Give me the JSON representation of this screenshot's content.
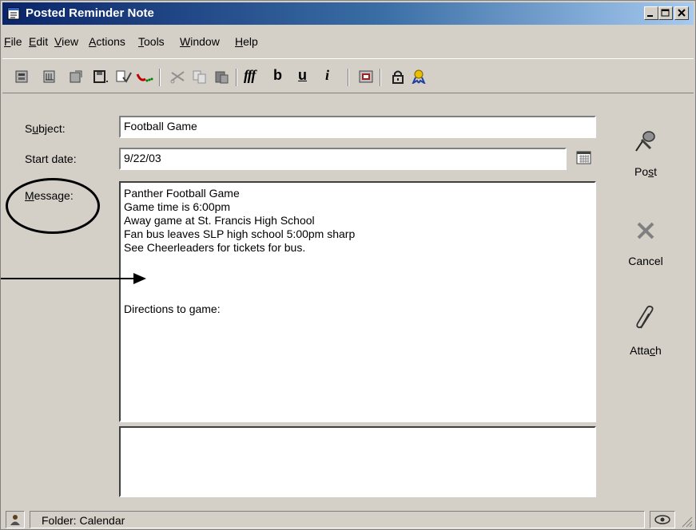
{
  "window": {
    "title": "Posted Reminder Note",
    "controls": [
      "minimize",
      "maximize",
      "close"
    ]
  },
  "menu": [
    {
      "label": "File",
      "key": "F",
      "rest": "ile"
    },
    {
      "label": "Edit",
      "key": "E",
      "rest": "dit"
    },
    {
      "label": "View",
      "key": "V",
      "rest": "iew"
    },
    {
      "label": "Actions",
      "key": "A",
      "rest": "ctions"
    },
    {
      "label": "Tools",
      "key": "T",
      "rest": "ools"
    },
    {
      "label": "Window",
      "key": "W",
      "rest": "indow"
    },
    {
      "label": "Help",
      "key": "H",
      "rest": "elp"
    }
  ],
  "toolbar": {
    "icons": [
      "send-options-icon",
      "address-book-icon",
      "open-icon",
      "save-draft-icon",
      "spell-check-icon",
      "redirect-icon",
      "cut-icon",
      "copy-icon",
      "paste-icon",
      "font-icon",
      "bold-icon",
      "underline-icon",
      "italic-icon",
      "calendar-book-icon",
      "lock-icon",
      "award-icon"
    ],
    "font_label": "fff",
    "bold_label": "b",
    "underline_label": "u",
    "italic_label": "i"
  },
  "form": {
    "subject_label_pre": "S",
    "subject_label_key": "u",
    "subject_label_post": "bject:",
    "subject_value": "Football Game",
    "start_date_label": "Start date:",
    "start_date_value": "9/22/03",
    "message_label_key": "M",
    "message_label_post": "essage:",
    "message_lines": [
      "Panther Football Game",
      "Game time is 6:00pm",
      "Away game at St. Francis High School",
      "Fan bus leaves SLP high school 5:00pm sharp",
      "See Cheerleaders for tickets for bus.",
      "",
      "Directions to game:"
    ]
  },
  "actions": {
    "post_pre": "Po",
    "post_key": "s",
    "post_post": "t",
    "cancel_label": "Cancel",
    "attach_pre": "Atta",
    "attach_key": "c",
    "attach_post": "h"
  },
  "status": {
    "folder_text": "Folder: Calendar"
  }
}
